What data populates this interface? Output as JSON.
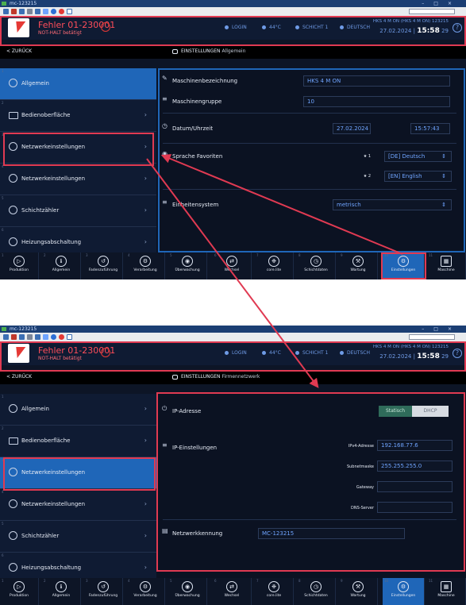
{
  "window": {
    "title": "mc-123215",
    "controls": [
      "–",
      "□",
      "×"
    ]
  },
  "header": {
    "error_title": "Fehler 01-230001",
    "error_sub": "NOT-HALT betätigt",
    "login": "LOGIN",
    "temperature": "44°C",
    "shift": "SCHICHT 1",
    "language": "DEUTSCH",
    "machine_line": "HKS 4 M ON (HKS 4 M ON) 123215",
    "date": "27.02.2024",
    "time": "15:58",
    "seconds": "29",
    "help": "?"
  },
  "navbar": {
    "back": "< ZURÜCK",
    "crumb_top_main": "EINSTELLUNGEN",
    "crumb_top_sub": "Allgemein",
    "crumb_bottom_main": "EINSTELLUNGEN",
    "crumb_bottom_sub": "Firmennetzwerk"
  },
  "sidebar": {
    "items": [
      {
        "label": "Allgemein"
      },
      {
        "label": "Bedienoberfläche"
      },
      {
        "label": "Netzwerkeinstellungen"
      },
      {
        "label": "Netzwerkeinstellungen"
      },
      {
        "label": "Schichtzähler"
      },
      {
        "label": "Heizungsabschaltung"
      }
    ]
  },
  "top_content": {
    "machine_name_label": "Maschinenbezeichnung",
    "machine_name_value": "HKS 4 M ON",
    "machine_group_label": "Maschinengruppe",
    "machine_group_value": "10",
    "datetime_label": "Datum/Uhrzeit",
    "date_value": "27.02.2024",
    "time_value": "15:57:43",
    "language_label": "Sprache Favoriten",
    "lang1_marker": "1",
    "lang1_value": "[DE] Deutsch",
    "lang2_marker": "2",
    "lang2_value": "[EN] English",
    "units_label": "Einheitensystem",
    "units_value": "metrisch"
  },
  "bottom_content": {
    "ip_address_label": "IP-Adresse",
    "static_label": "Statisch",
    "dhcp_label": "DHCP",
    "ip_settings_label": "IP-Einstellungen",
    "ipv4_label": "IPv4-Adresse",
    "ipv4_value": "192.168.77.6",
    "subnet_label": "Subnetmaske",
    "subnet_value": "255.255.255.0",
    "gateway_label": "Gateway",
    "gateway_value": "",
    "dns_label": "DNS-Server",
    "dns_value": "",
    "network_id_label": "Netzwerkkennung",
    "network_id_value": "MC-123215"
  },
  "bottombar": {
    "buttons": [
      {
        "label": "Produktion"
      },
      {
        "label": "Allgemein"
      },
      {
        "label": "Fadenzuführung"
      },
      {
        "label": "Verarbeitung"
      },
      {
        "label": "Überwachung"
      },
      {
        "label": "Wechsel"
      },
      {
        "label": "core.lite"
      },
      {
        "label": "Schichtdaten"
      },
      {
        "label": "Wartung"
      },
      {
        "label": "Einstellungen"
      },
      {
        "label": "Maschine"
      }
    ]
  },
  "colors": {
    "accent": "#1f66b8",
    "highlight": "#e03a52",
    "value_text": "#6fa4ff",
    "error": "#ff4d5a"
  }
}
